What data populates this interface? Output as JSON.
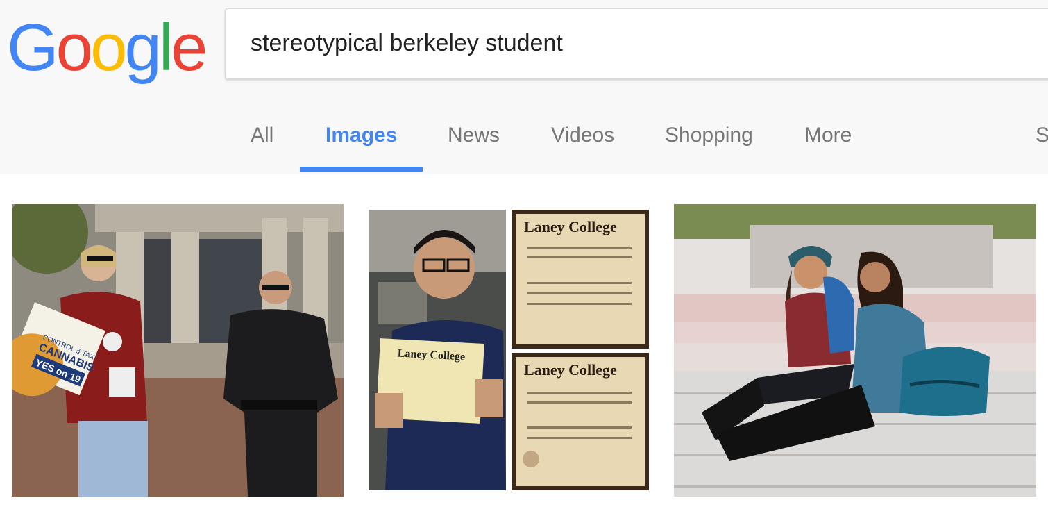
{
  "logo": {
    "letters": [
      "G",
      "o",
      "o",
      "g",
      "l",
      "e"
    ],
    "colors": [
      "#4285f4",
      "#ea4335",
      "#fbbc05",
      "#4285f4",
      "#34a853",
      "#ea4335"
    ]
  },
  "search": {
    "query": "stereotypical berkeley student"
  },
  "tabs": [
    {
      "label": "All"
    },
    {
      "label": "Images",
      "active": true
    },
    {
      "label": "News"
    },
    {
      "label": "Videos"
    },
    {
      "label": "Shopping"
    },
    {
      "label": "More"
    },
    {
      "label": "S"
    }
  ],
  "results": {
    "image1": {
      "sign_text_1": "CONTROL & TAX",
      "sign_text_2": "CANNABIS",
      "sign_text_3": "YES on 19"
    },
    "image2": {
      "diploma_title": "Laney College"
    }
  }
}
